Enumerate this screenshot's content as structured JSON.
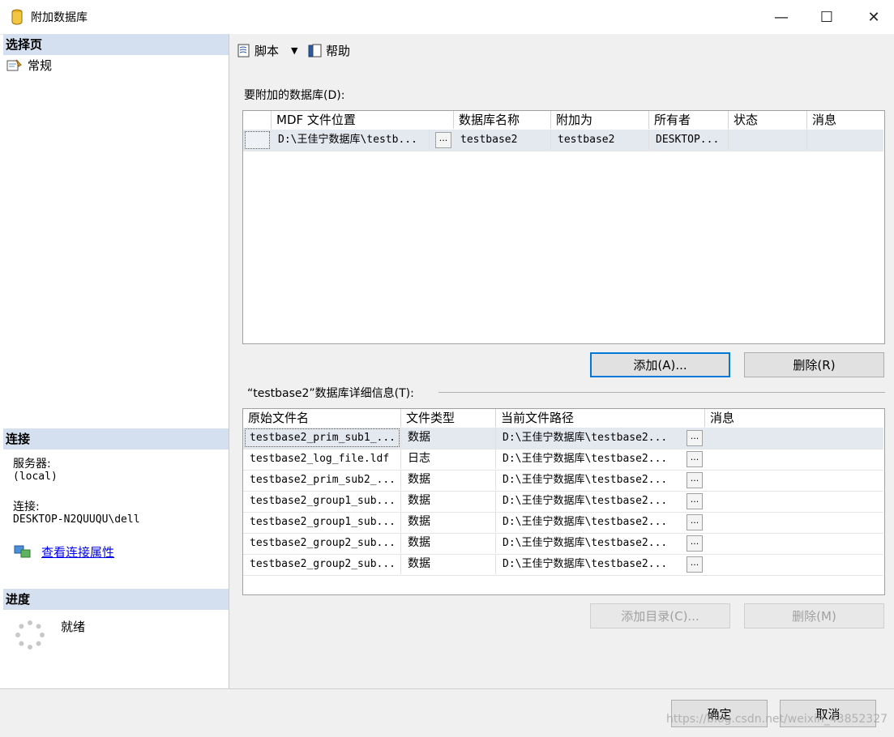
{
  "window": {
    "title": "附加数据库",
    "controls": {
      "minimize": "—",
      "maximize": "☐",
      "close": "✕"
    }
  },
  "left": {
    "select_page_header": "选择页",
    "pages": [
      {
        "label": "常规",
        "icon": "page-settings-icon"
      }
    ],
    "connection_header": "连接",
    "server_label": "服务器:",
    "server_value": "(local)",
    "connection_label": "连接:",
    "connection_value": "DESKTOP-N2QUUQU\\dell",
    "view_props_link": "查看连接属性",
    "progress_header": "进度",
    "progress_status": "就绪"
  },
  "toolbar": {
    "script_label": "脚本",
    "help_label": "帮助"
  },
  "attach": {
    "section_label": "要附加的数据库(D):",
    "columns": [
      "MDF 文件位置",
      "数据库名称",
      "附加为",
      "所有者",
      "状态",
      "消息"
    ],
    "rows": [
      {
        "mdf": "D:\\王佳宁数据库\\testb...",
        "dbname": "testbase2",
        "attach_as": "testbase2",
        "owner": "DESKTOP...",
        "status": "",
        "message": ""
      }
    ],
    "add_button": "添加(A)...",
    "remove_button": "删除(R)"
  },
  "details": {
    "section_label": "“testbase2”数据库详细信息(T):",
    "columns": [
      "原始文件名",
      "文件类型",
      "当前文件路径",
      "消息"
    ],
    "rows": [
      {
        "name": "testbase2_prim_sub1_...",
        "type": "数据",
        "path": "D:\\王佳宁数据库\\testbase2...",
        "message": ""
      },
      {
        "name": "testbase2_log_file.ldf",
        "type": "日志",
        "path": "D:\\王佳宁数据库\\testbase2...",
        "message": ""
      },
      {
        "name": "testbase2_prim_sub2_...",
        "type": "数据",
        "path": "D:\\王佳宁数据库\\testbase2...",
        "message": ""
      },
      {
        "name": "testbase2_group1_sub...",
        "type": "数据",
        "path": "D:\\王佳宁数据库\\testbase2...",
        "message": ""
      },
      {
        "name": "testbase2_group1_sub...",
        "type": "数据",
        "path": "D:\\王佳宁数据库\\testbase2...",
        "message": ""
      },
      {
        "name": "testbase2_group2_sub...",
        "type": "数据",
        "path": "D:\\王佳宁数据库\\testbase2...",
        "message": ""
      },
      {
        "name": "testbase2_group2_sub...",
        "type": "数据",
        "path": "D:\\王佳宁数据库\\testbase2...",
        "message": ""
      }
    ],
    "add_catalog_button": "添加目录(C)...",
    "remove_button": "删除(M)"
  },
  "footer": {
    "ok_button": "确定",
    "cancel_button": "取消",
    "watermark": "https://blog.csdn.net/weixin_43852327"
  },
  "ellipsis": "..."
}
